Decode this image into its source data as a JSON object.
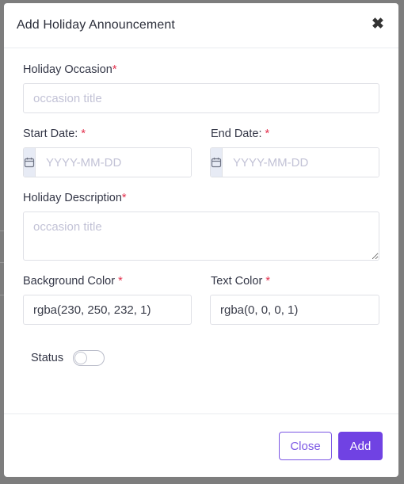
{
  "modal": {
    "title": "Add Holiday Announcement",
    "close_icon": "close-icon"
  },
  "form": {
    "occasion": {
      "label": "Holiday Occasion",
      "required": "*",
      "placeholder": "occasion title",
      "value": ""
    },
    "start_date": {
      "label": "Start Date: ",
      "required": "*",
      "placeholder": "YYYY-MM-DD",
      "icon": "calendar-icon"
    },
    "end_date": {
      "label": "End Date: ",
      "required": "*",
      "placeholder": "YYYY-MM-DD",
      "icon": "calendar-icon"
    },
    "description": {
      "label": "Holiday Description",
      "required": "*",
      "placeholder": "occasion title"
    },
    "background_color": {
      "label": "Background Color ",
      "required": "*",
      "value": "rgba(230, 250, 232, 1)"
    },
    "text_color": {
      "label": "Text Color ",
      "required": "*",
      "value": "rgba(0, 0, 0, 1)"
    },
    "status": {
      "label": "Status",
      "checked": false
    }
  },
  "footer": {
    "close_label": "Close",
    "add_label": "Add"
  },
  "colors": {
    "accent": "#7042e3",
    "required": "#e3304d",
    "placeholder": "#c2c2d6",
    "backdrop": "#7d7d7d"
  }
}
